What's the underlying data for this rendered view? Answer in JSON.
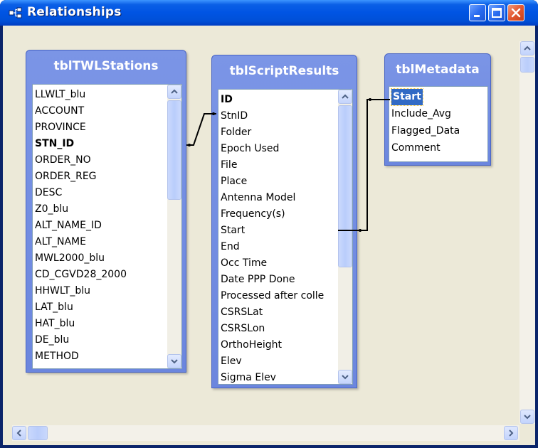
{
  "window": {
    "title": "Relationships",
    "controls": [
      "minimize-icon",
      "maximize-icon",
      "close-icon"
    ]
  },
  "tables": [
    {
      "name": "tblTWLStations",
      "fields": [
        "LLWLT_blu",
        "ACCOUNT",
        "PROVINCE",
        "STN_ID",
        "ORDER_NO",
        "ORDER_REG",
        "DESC",
        "Z0_blu",
        "ALT_NAME_ID",
        "ALT_NAME",
        "MWL2000_blu",
        "CD_CGVD28_2000",
        "HHWLT_blu",
        "LAT_blu",
        "HAT_blu",
        "DE_blu",
        "METHOD"
      ],
      "key_field": "STN_ID"
    },
    {
      "name": "tblScriptResults",
      "fields": [
        "ID",
        "StnID",
        "Folder",
        "Epoch Used",
        "File",
        "Place",
        "Antenna Model",
        "Frequency(s)",
        "Start",
        "End",
        "Occ Time",
        "Date PPP Done",
        "Processed after colle",
        "CSRSLat",
        "CSRSLon",
        "OrthoHeight",
        "Elev",
        "Sigma Elev"
      ],
      "key_field": "ID"
    },
    {
      "name": "tblMetadata",
      "fields": [
        "Start",
        "Include_Avg",
        "Flagged_Data",
        "Comment"
      ],
      "selected_field": "Start"
    }
  ],
  "relationships": [
    {
      "from": "tblTWLStations.STN_ID",
      "to": "tblScriptResults.StnID"
    },
    {
      "from": "tblScriptResults.Start",
      "to": "tblMetadata.Start"
    }
  ],
  "colors": {
    "titlebar": "#0054e3",
    "table_header": "#7b95e6",
    "selection": "#316ac5",
    "workspace": "#ece9d8"
  }
}
